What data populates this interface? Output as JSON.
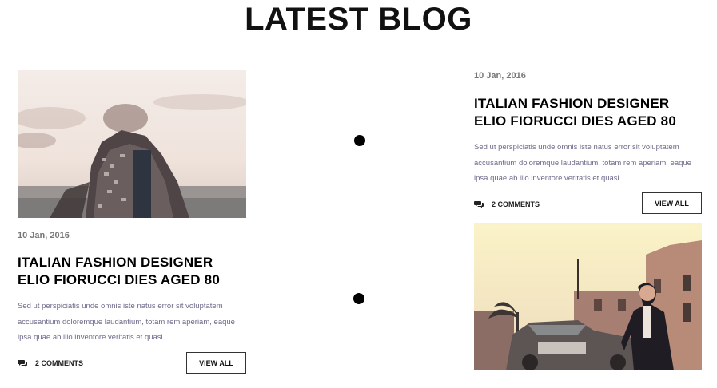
{
  "section": {
    "title": "LATEST BLOG"
  },
  "posts": [
    {
      "date": "10 Jan, 2016",
      "title_line1": "ITALIAN FASHION DESIGNER",
      "title_line2": "ELIO FIORUCCI DIES AGED 80",
      "excerpt_line1": "Sed ut perspiciatis unde omnis iste natus error sit voluptatem",
      "excerpt_line2": "accusantium doloremque laudantium, totam rem aperiam, eaque",
      "excerpt_line3": "ipsa quae ab illo inventore veritatis et quasi",
      "comments": "2 COMMENTS",
      "button": "VIEW ALL",
      "image_icon": "double-exposure-photo"
    },
    {
      "date": "10 Jan, 2016",
      "title_line1": "ITALIAN FASHION DESIGNER",
      "title_line2": "ELIO FIORUCCI DIES AGED 80",
      "excerpt_line1": "Sed ut perspiciatis unde omnis iste natus error sit voluptatem",
      "excerpt_line2": "accusantium doloremque laudantium, totam rem aperiam, eaque",
      "excerpt_line3": "ipsa quae ab illo inventore veritatis et quasi",
      "comments": "2 COMMENTS",
      "button": "VIEW ALL",
      "image_icon": "vintage-car-photo"
    }
  ],
  "colors": {
    "excerpt": "#6f6a8a",
    "date": "#777777",
    "dot": "#000000"
  }
}
